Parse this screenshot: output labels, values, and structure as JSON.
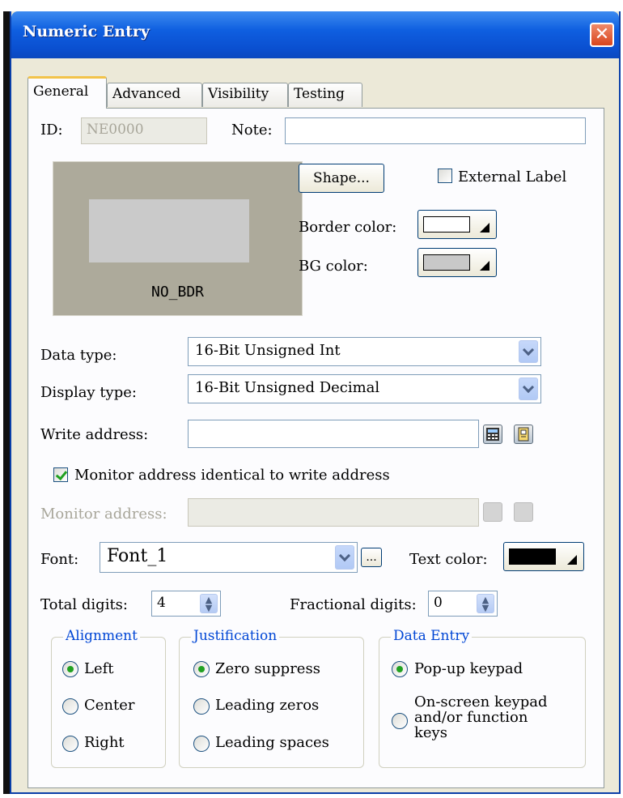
{
  "window": {
    "title": "Numeric Entry"
  },
  "tabs": [
    {
      "label": "General",
      "active": true
    },
    {
      "label": "Advanced",
      "active": false
    },
    {
      "label": "Visibility",
      "active": false
    },
    {
      "label": "Testing",
      "active": false
    }
  ],
  "general": {
    "id_label": "ID:",
    "id_value": "NE0000",
    "note_label": "Note:",
    "note_value": "",
    "preview_label": "NO_BDR",
    "shape_button": "Shape...",
    "external_label": "External Label",
    "external_label_checked": false,
    "border_color_label": "Border color:",
    "border_color": "#ffffff",
    "bg_color_label": "BG color:",
    "bg_color": "#c8c8c8",
    "data_type_label": "Data type:",
    "data_type_value": "16-Bit Unsigned Int",
    "display_type_label": "Display type:",
    "display_type_value": "16-Bit Unsigned Decimal",
    "write_address_label": "Write address:",
    "write_address_value": "",
    "monitor_identical_label": "Monitor address identical to write address",
    "monitor_identical_checked": true,
    "monitor_address_label": "Monitor address:",
    "monitor_address_value": "",
    "font_label": "Font:",
    "font_value": "Font_1",
    "font_more_button": "...",
    "text_color_label": "Text color:",
    "text_color": "#000000",
    "total_digits_label": "Total digits:",
    "total_digits_value": "4",
    "fractional_digits_label": "Fractional digits:",
    "fractional_digits_value": "0"
  },
  "alignment": {
    "title": "Alignment",
    "options": [
      "Left",
      "Center",
      "Right"
    ],
    "selected": "Left"
  },
  "justification": {
    "title": "Justification",
    "options": [
      "Zero suppress",
      "Leading zeros",
      "Leading spaces"
    ],
    "selected": "Zero suppress"
  },
  "data_entry": {
    "title": "Data Entry",
    "option_popup": "Pop-up keypad",
    "option_onscreen_line1": "On-screen keypad",
    "option_onscreen_line2": "and/or function",
    "option_onscreen_line3": "keys",
    "selected": "Pop-up keypad"
  },
  "colors": {
    "titlebar": "#0a4fd0",
    "group_title": "#0046d5",
    "check_green": "#21a121"
  },
  "icons": [
    "close-icon",
    "calculator-icon",
    "address-book-icon",
    "dropdown-arrow-icon",
    "spinner-icon"
  ]
}
